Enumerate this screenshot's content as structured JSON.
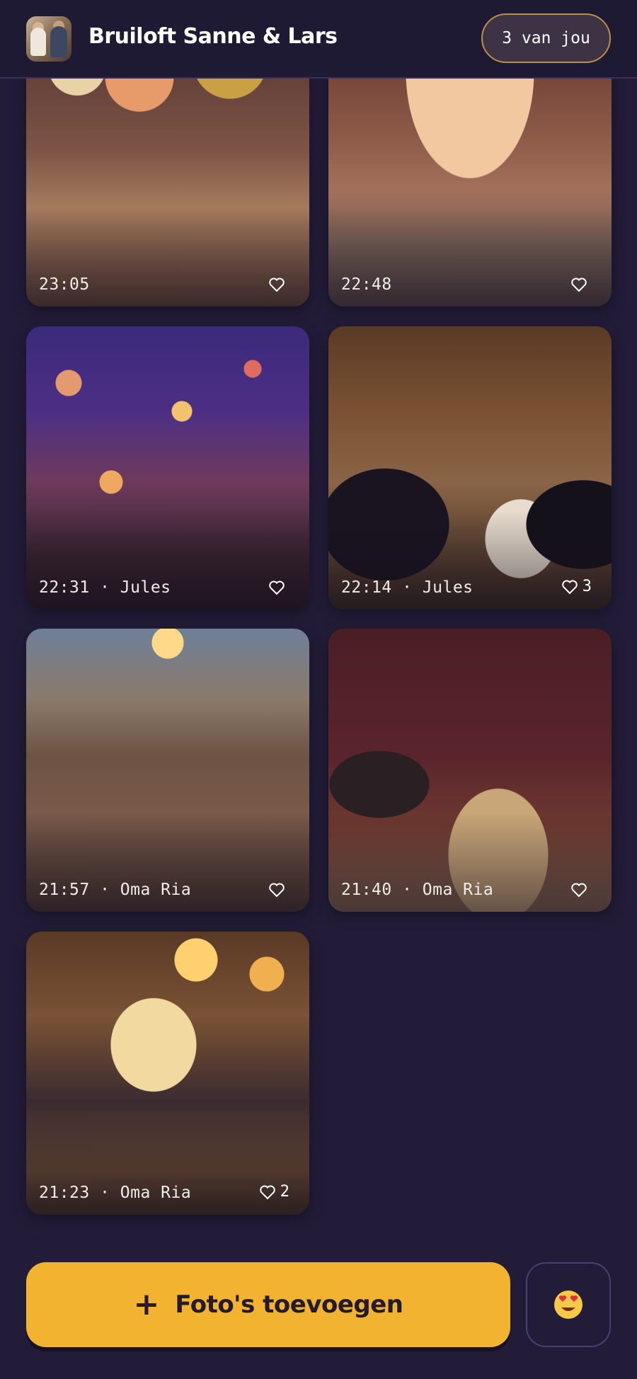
{
  "header": {
    "title": "Bruiloft Sanne & Lars",
    "count_label": "3 van jou",
    "avatar_icon": "couple-avatar"
  },
  "photos": [
    {
      "meta": "23:05",
      "likes": ""
    },
    {
      "meta": "22:48",
      "likes": ""
    },
    {
      "meta": "22:31 · Jules",
      "likes": ""
    },
    {
      "meta": "22:14 · Jules",
      "likes": "3"
    },
    {
      "meta": "21:57 · Oma Ria",
      "likes": ""
    },
    {
      "meta": "21:40 · Oma Ria",
      "likes": ""
    },
    {
      "meta": "21:23 · Oma Ria",
      "likes": "2"
    }
  ],
  "actions": {
    "add_photos_label": "Foto's toevoegen",
    "add_icon": "+",
    "reaction_emoji": "😍"
  },
  "colors": {
    "background": "#221c38",
    "accent": "#f2b331",
    "pill_border": "#b8904a"
  }
}
